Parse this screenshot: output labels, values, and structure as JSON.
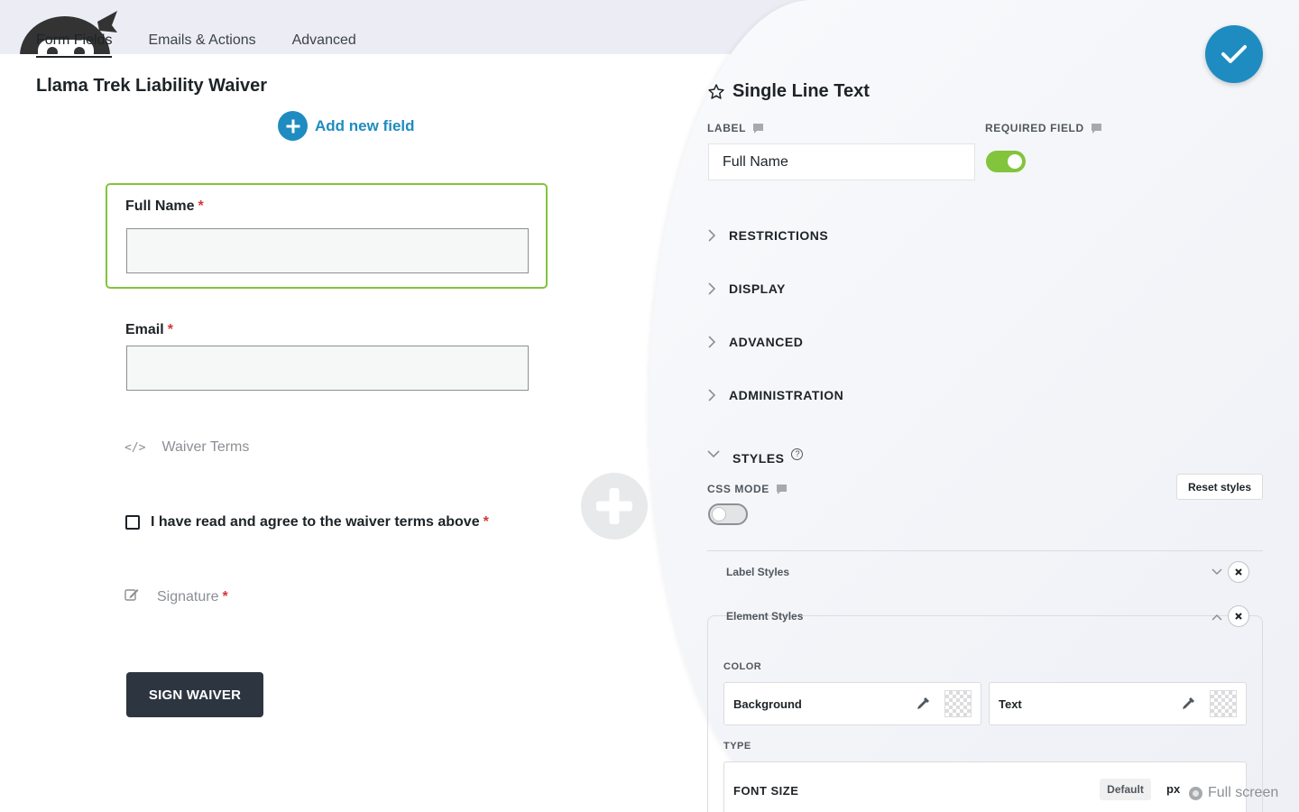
{
  "tabs": [
    {
      "label": "Form Fields"
    },
    {
      "label": "Emails & Actions"
    },
    {
      "label": "Advanced"
    }
  ],
  "form": {
    "title": "Llama Trek Liability Waiver",
    "add_field_label": "Add new field",
    "fields": {
      "full_name": {
        "label": "Full Name",
        "required_mark": "*"
      },
      "email": {
        "label": "Email",
        "required_mark": "*"
      },
      "waiver_terms": {
        "label": "Waiver Terms",
        "icon": "code-icon"
      },
      "agree": {
        "label": "I have read and agree to the waiver terms above",
        "required_mark": "*"
      },
      "signature": {
        "label": "Signature",
        "required_mark": "*",
        "icon": "edit-icon"
      }
    },
    "submit_label": "SIGN WAIVER"
  },
  "panel": {
    "title": "Single Line Text",
    "label_heading": "LABEL",
    "label_value": "Full Name",
    "required_heading": "REQUIRED FIELD",
    "required_on": true,
    "sections": [
      "RESTRICTIONS",
      "DISPLAY",
      "ADVANCED",
      "ADMINISTRATION"
    ],
    "styles_heading": "STYLES",
    "help_glyph": "?",
    "css_mode_heading": "CSS MODE",
    "css_mode_on": false,
    "reset_label": "Reset styles",
    "label_styles": "Label Styles",
    "element_styles": "Element Styles",
    "color_heading": "COLOR",
    "color_background": "Background",
    "color_text": "Text",
    "type_heading": "TYPE",
    "font_size_label": "FONT SIZE",
    "font_size_default": "Default",
    "font_size_unit": "px",
    "fullscreen_label": "Full screen"
  },
  "colors": {
    "accent": "#1e8cc0",
    "active_border": "#82c43c",
    "required": "#d63638",
    "submit_bg": "#2d3540"
  }
}
